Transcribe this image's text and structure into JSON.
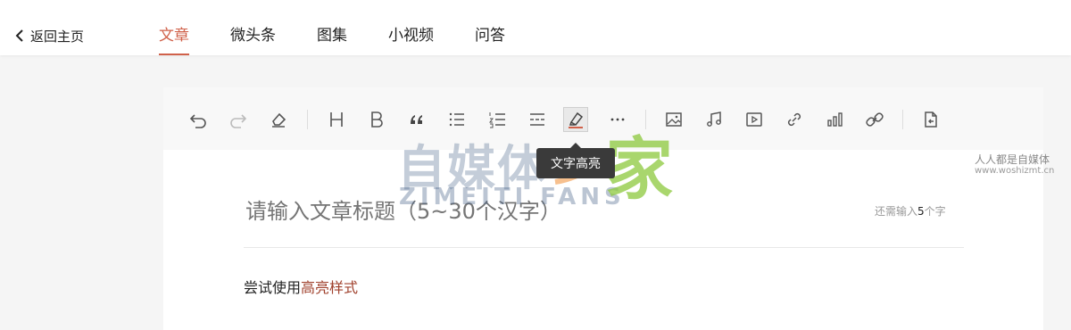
{
  "nav": {
    "back_label": "返回主页",
    "tabs": [
      {
        "label": "文章",
        "active": true
      },
      {
        "label": "微头条",
        "active": false
      },
      {
        "label": "图集",
        "active": false
      },
      {
        "label": "小视频",
        "active": false
      },
      {
        "label": "问答",
        "active": false
      }
    ]
  },
  "toolbar": {
    "buttons": [
      "undo-icon",
      "redo-icon",
      "eraser-icon",
      "heading-icon",
      "bold-icon",
      "quote-icon",
      "bullet-list-icon",
      "numbered-list-icon",
      "divider-line-icon",
      "highlight-icon",
      "more-icon",
      "image-icon",
      "music-icon",
      "video-icon",
      "link-icon",
      "chart-icon",
      "link-card-icon",
      "import-document-icon"
    ],
    "active_button": "highlight-icon",
    "tooltip": "文字高亮"
  },
  "editor": {
    "title_placeholder": "请输入文章标题（5~30个汉字）",
    "counter_prefix": "还需输入",
    "counter_value": "5",
    "counter_suffix": "个字",
    "body_plain": "尝试使用",
    "body_highlight": "高亮样式"
  },
  "watermark": {
    "main": "自媒体",
    "jia": "家",
    "sub": "ZIMEITI FANS",
    "right_line1": "人人都是自媒体",
    "right_line2": "www.woshizmt.cn"
  },
  "colors": {
    "accent": "#d0614a",
    "highlight_text": "#a0412d",
    "page_background": "#f5f5f5"
  }
}
